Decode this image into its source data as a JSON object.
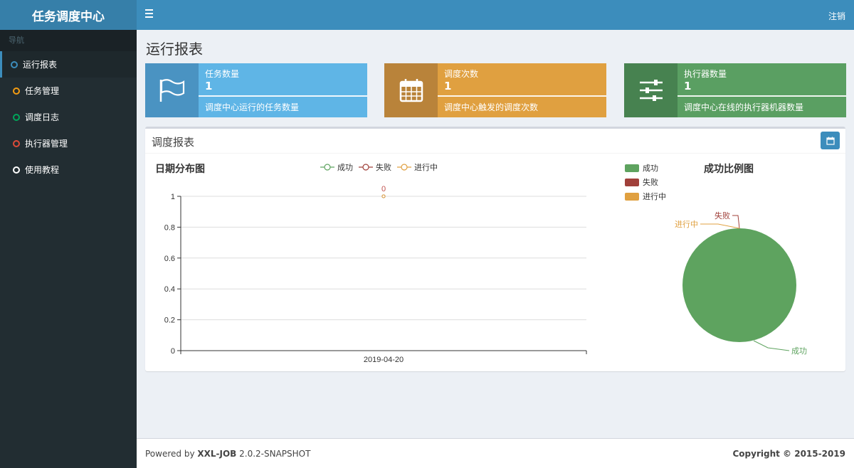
{
  "app": {
    "title": "任务调度中心"
  },
  "header": {
    "logout": "注销"
  },
  "sidebar": {
    "header": "导航",
    "items": [
      {
        "label": "运行报表",
        "color": "#3c8dbc"
      },
      {
        "label": "任务管理",
        "color": "#f39c12"
      },
      {
        "label": "调度日志",
        "color": "#00a65a"
      },
      {
        "label": "执行器管理",
        "color": "#dd4b39"
      },
      {
        "label": "使用教程",
        "color": "#ffffff"
      }
    ]
  },
  "page": {
    "title": "运行报表"
  },
  "stats": [
    {
      "label": "任务数量",
      "value": "1",
      "desc": "调度中心运行的任务数量",
      "icon": "flag-icon",
      "color": "#5fb5e6",
      "icon_bg": "#4a93c2"
    },
    {
      "label": "调度次数",
      "value": "1",
      "desc": "调度中心触发的调度次数",
      "icon": "calendar-icon",
      "color": "#e0a040",
      "icon_bg": "#b9833a"
    },
    {
      "label": "执行器数量",
      "value": "1",
      "desc": "调度中心在线的执行器机器数量",
      "icon": "sliders-icon",
      "color": "#5a9f62",
      "icon_bg": "#478250"
    }
  ],
  "report": {
    "title": "调度报表"
  },
  "line_chart": {
    "title": "日期分布图",
    "legend": [
      "成功",
      "失败",
      "进行中"
    ],
    "point_label": "0"
  },
  "pie_chart": {
    "title": "成功比例图",
    "legend": [
      "成功",
      "失败",
      "进行中"
    ],
    "labels": [
      "成功",
      "失败",
      "进行中"
    ]
  },
  "chart_data": [
    {
      "type": "line",
      "title": "日期分布图",
      "x": [
        "2019-04-20"
      ],
      "series": [
        {
          "name": "成功",
          "values": [
            0
          ],
          "color": "#5ea35f"
        },
        {
          "name": "失败",
          "values": [
            0
          ],
          "color": "#a0403a"
        },
        {
          "name": "进行中",
          "values": [
            0
          ],
          "color": "#e0a040"
        }
      ],
      "ylim": [
        0,
        1
      ],
      "yticks": [
        "0",
        "0.2",
        "0.4",
        "0.6",
        "0.8",
        "1"
      ],
      "grid": true,
      "legend": "top"
    },
    {
      "type": "pie",
      "title": "成功比例图",
      "categories": [
        "成功",
        "失败",
        "进行中"
      ],
      "values": [
        1,
        0,
        0
      ],
      "colors": [
        "#5ea35f",
        "#a0403a",
        "#e0a040"
      ],
      "legend": "top-left"
    }
  ],
  "footer": {
    "powered_prefix": "Powered by ",
    "brand": "XXL-JOB",
    "version": " 2.0.2-SNAPSHOT",
    "copyright": "Copyright © 2015-2019"
  }
}
